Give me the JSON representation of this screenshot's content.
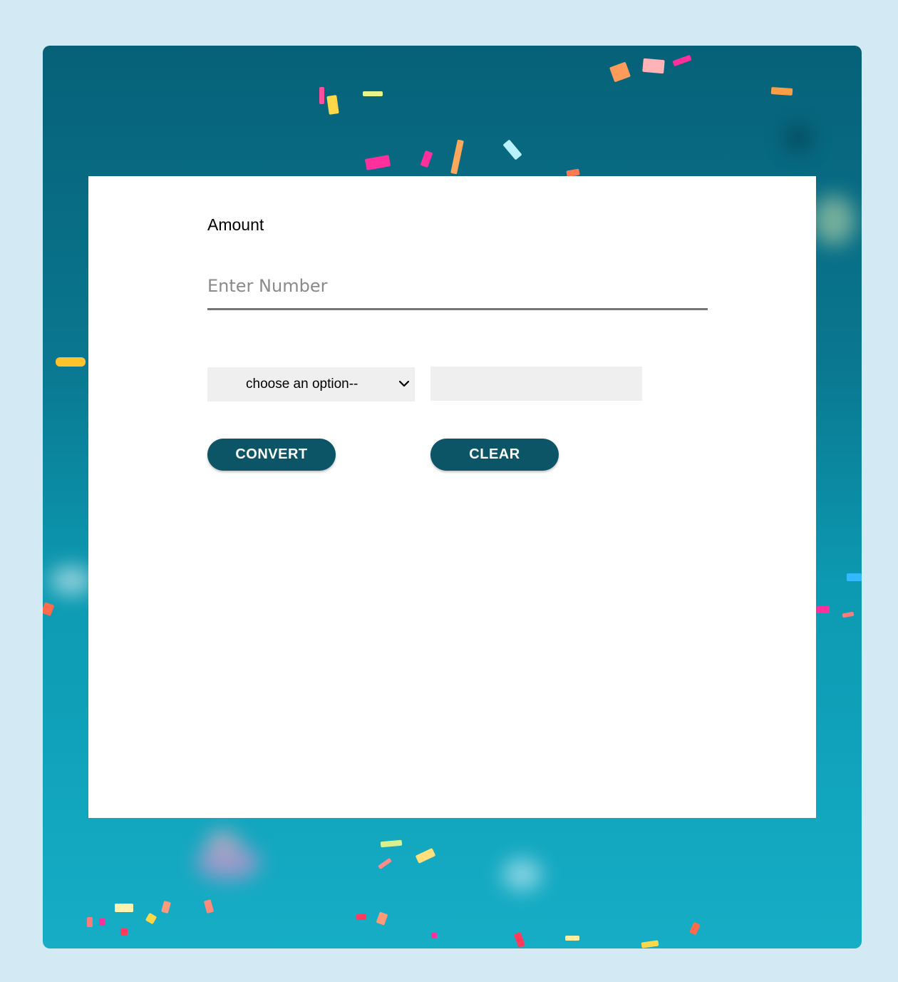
{
  "form": {
    "amount_label": "Amount",
    "amount_placeholder": "Enter Number",
    "select_value": "choose an option--",
    "result_value": "",
    "convert_label": "CONVERT",
    "clear_label": "CLEAR"
  },
  "icons": {
    "select_arrow": "chevron-down-icon"
  },
  "colors": {
    "page_background": "#d3eaf4",
    "button": "#0b5567",
    "button_text": "#ffffff",
    "field_background": "#efefef",
    "underline": "#767676"
  }
}
